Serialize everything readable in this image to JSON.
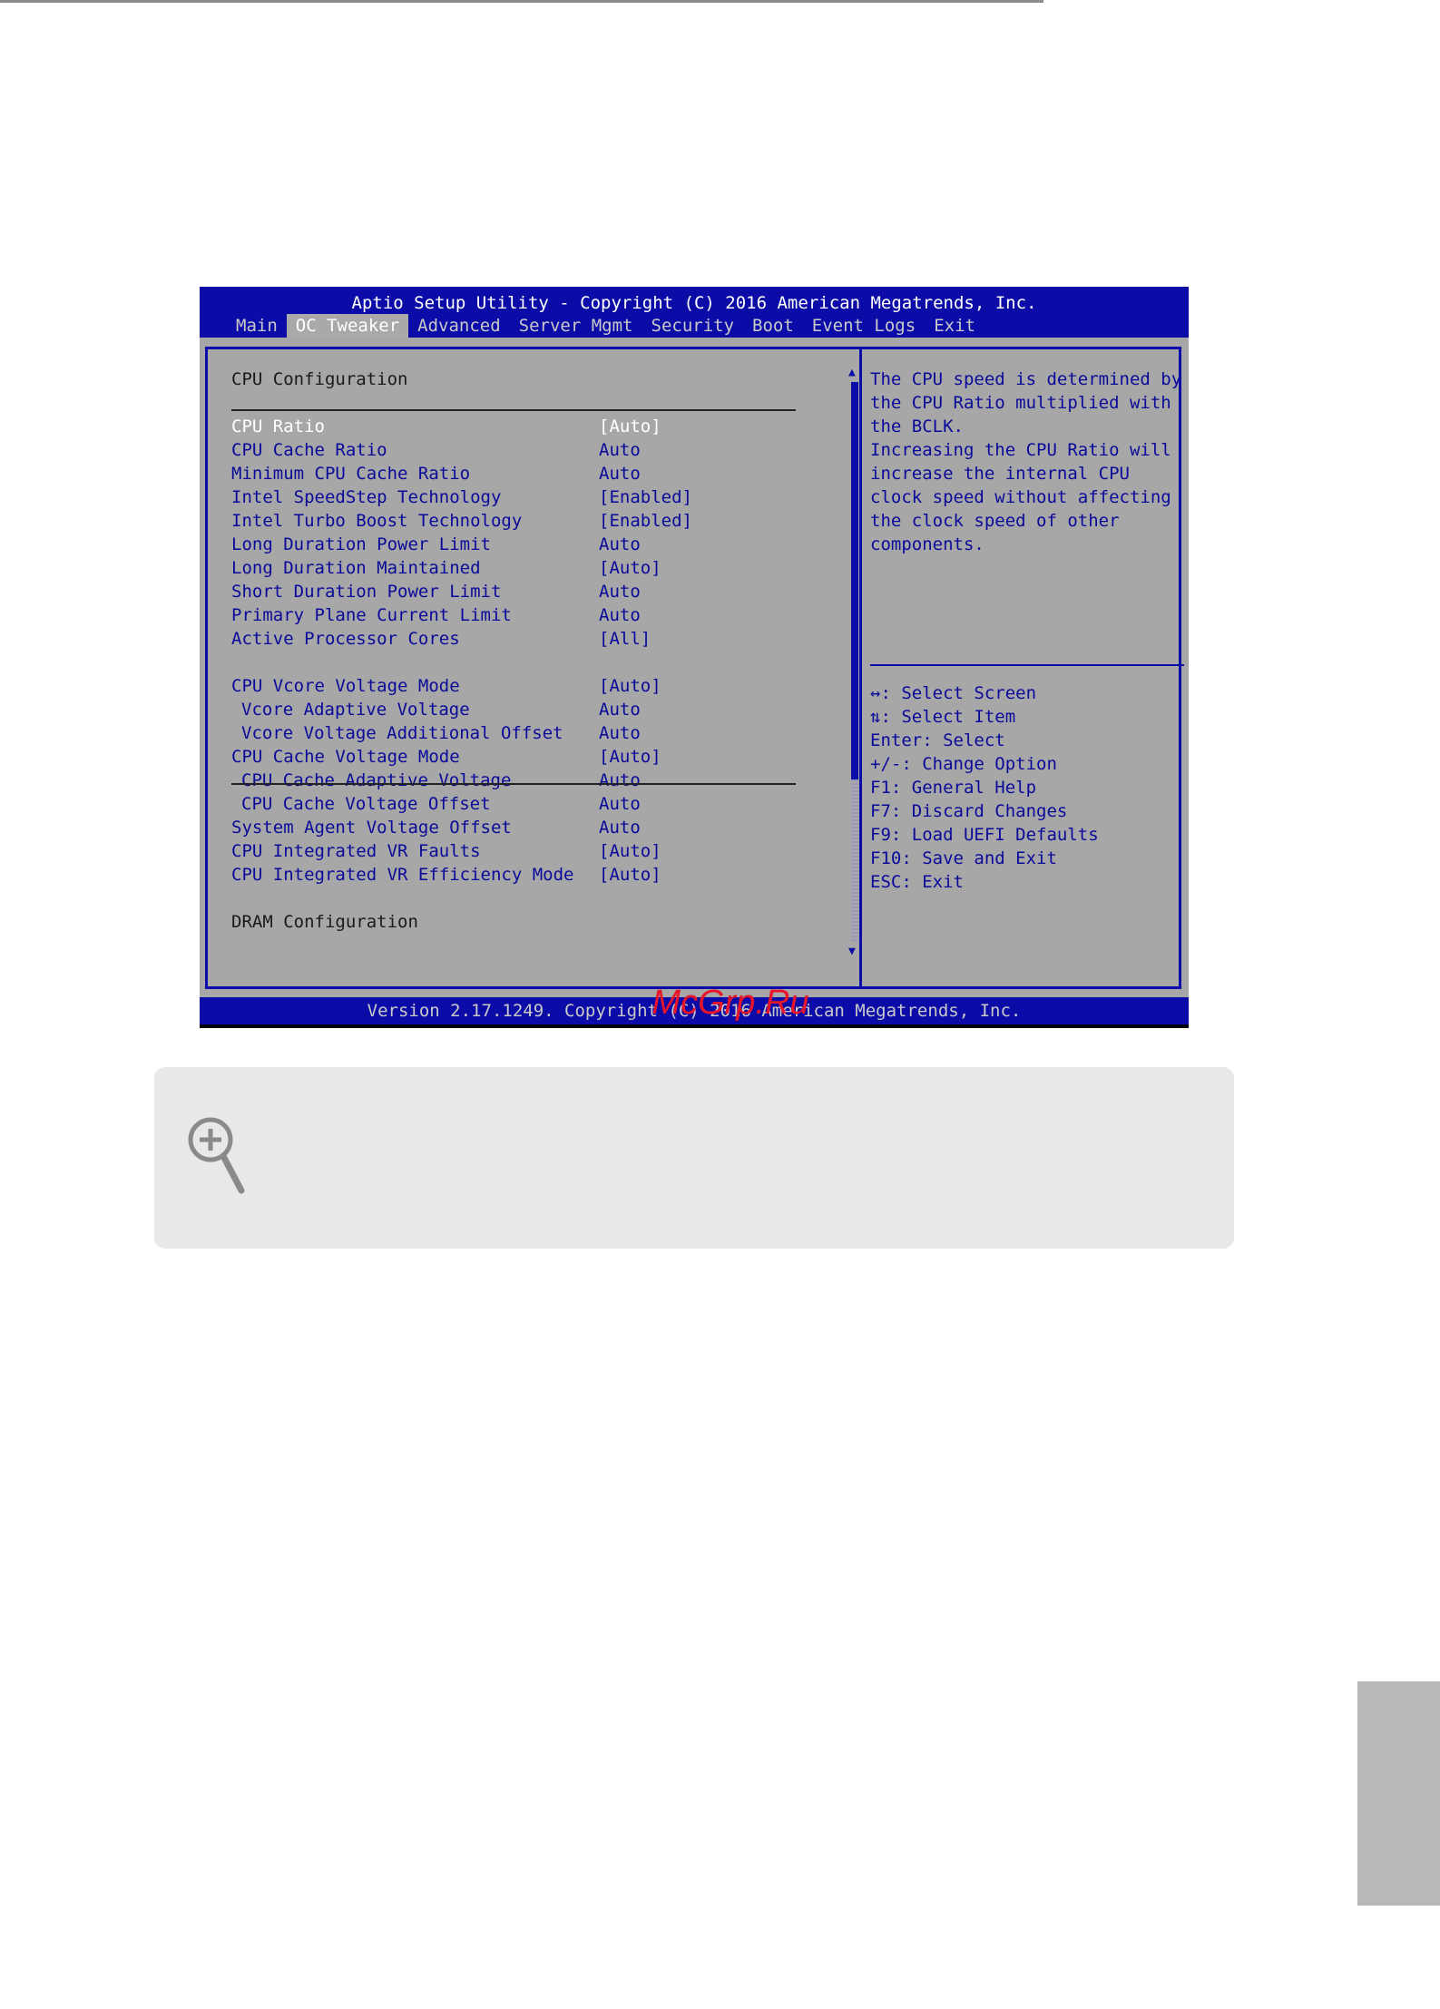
{
  "bios": {
    "title": "Aptio Setup Utility - Copyright (C) 2016 American Megatrends, Inc.",
    "menu": [
      {
        "label": "Main",
        "active": false
      },
      {
        "label": "OC Tweaker",
        "active": true
      },
      {
        "label": "Advanced",
        "active": false
      },
      {
        "label": "Server Mgmt",
        "active": false
      },
      {
        "label": "Security",
        "active": false
      },
      {
        "label": "Boot",
        "active": false
      },
      {
        "label": "Event Logs",
        "active": false
      },
      {
        "label": "Exit",
        "active": false
      }
    ],
    "section_cpu": "CPU Configuration",
    "options_group1": [
      {
        "label": "CPU Ratio",
        "value": "[Auto]"
      },
      {
        "label": "CPU Cache Ratio",
        "value": "Auto"
      },
      {
        "label": "Minimum CPU Cache Ratio",
        "value": "Auto"
      },
      {
        "label": "Intel SpeedStep Technology",
        "value": "[Enabled]"
      },
      {
        "label": "Intel Turbo Boost Technology",
        "value": "[Enabled]"
      },
      {
        "label": "Long Duration Power Limit",
        "value": "Auto"
      },
      {
        "label": "Long Duration Maintained",
        "value": "[Auto]"
      },
      {
        "label": "Short Duration Power Limit",
        "value": "Auto"
      },
      {
        "label": "Primary Plane Current Limit",
        "value": "Auto"
      },
      {
        "label": "Active Processor Cores",
        "value": "[All]"
      }
    ],
    "options_group2": [
      {
        "label": "CPU Vcore Voltage Mode",
        "value": "[Auto]",
        "indent": false
      },
      {
        "label": "Vcore Adaptive Voltage",
        "value": "Auto",
        "indent": true
      },
      {
        "label": "Vcore Voltage Additional Offset",
        "value": "Auto",
        "indent": true
      },
      {
        "label": "CPU Cache Voltage Mode",
        "value": "[Auto]",
        "indent": false
      },
      {
        "label": "CPU Cache Adaptive Voltage",
        "value": "Auto",
        "indent": true
      },
      {
        "label": "CPU Cache Voltage Offset",
        "value": "Auto",
        "indent": true
      },
      {
        "label": "System Agent Voltage Offset",
        "value": "Auto",
        "indent": false
      },
      {
        "label": "CPU Integrated VR Faults",
        "value": "[Auto]",
        "indent": false
      },
      {
        "label": "CPU Integrated VR Efficiency Mode",
        "value": "[Auto]",
        "indent": false
      }
    ],
    "section_dram": "DRAM Configuration",
    "help_text": [
      "The CPU speed is determined by",
      "the CPU Ratio multiplied with",
      "the BCLK.",
      "Increasing the CPU Ratio will",
      "increase the internal CPU",
      "clock speed without affecting",
      "the clock speed of other",
      "components."
    ],
    "keys": [
      "↔: Select Screen",
      "⇅: Select Item",
      "Enter: Select",
      "+/-: Change Option",
      "F1: General Help",
      "F7: Discard Changes",
      "F9: Load UEFI Defaults",
      "F10: Save and Exit",
      "ESC: Exit"
    ],
    "scroll_up": "▲",
    "scroll_down": "▼",
    "footer": "Version 2.17.1249. Copyright (C) 2016 American Megatrends, Inc.",
    "watermark": "McGrp.Ru"
  },
  "note": {
    "icon": "zoom-in-icon"
  },
  "colors": {
    "bios_blue": "#0b0ba8",
    "bios_gray": "#a7a7a7",
    "note_bg": "#e8e8e8"
  }
}
